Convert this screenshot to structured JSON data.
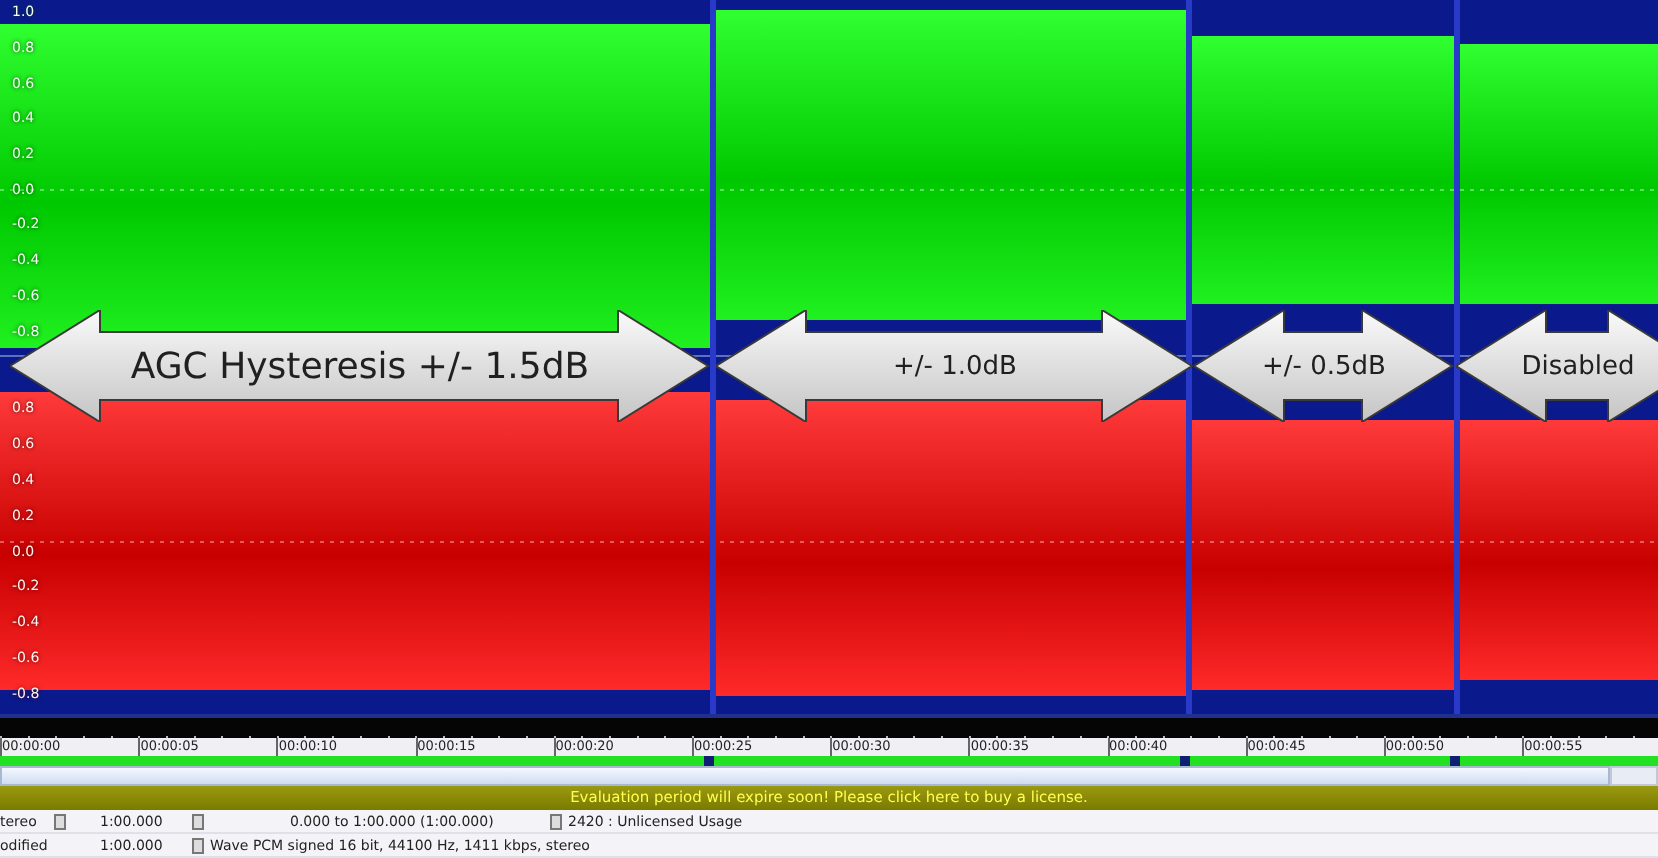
{
  "waveform": {
    "channels": [
      {
        "kind": "top",
        "scale": [
          "1.0",
          "0.8",
          "0.6",
          "0.4",
          "0.2",
          "0.0",
          "-0.2",
          "-0.4",
          "-0.6",
          "-0.8"
        ]
      },
      {
        "kind": "bottom",
        "scale": [
          "0.8",
          "0.6",
          "0.4",
          "0.2",
          "0.0",
          "-0.2",
          "-0.4",
          "-0.6",
          "-0.8"
        ]
      }
    ]
  },
  "annotations": [
    {
      "label": "AGC Hysteresis +/- 1.5dB"
    },
    {
      "label": "+/- 1.0dB"
    },
    {
      "label": "+/- 0.5dB"
    },
    {
      "label": "Disabled"
    }
  ],
  "timeline": {
    "labels": [
      "00:00:00",
      "00:00:05",
      "00:00:10",
      "00:00:15",
      "00:00:20",
      "00:00:25",
      "00:00:30",
      "00:00:35",
      "00:00:40",
      "00:00:45",
      "00:00:50",
      "00:00:55"
    ]
  },
  "banner": {
    "text": "Evaluation period will expire soon! Please click here to buy a license."
  },
  "status_bar": {
    "rows": [
      {
        "mode": "tereo",
        "length": "1:00.000",
        "selection": "0.000 to 1:00.000 (1:00.000)",
        "info": "2420 : Unlicensed Usage"
      },
      {
        "mode": "odified",
        "length": "1:00.000",
        "info": "Wave PCM signed 16 bit, 44100 Hz, 1411 kbps, stereo"
      }
    ]
  }
}
